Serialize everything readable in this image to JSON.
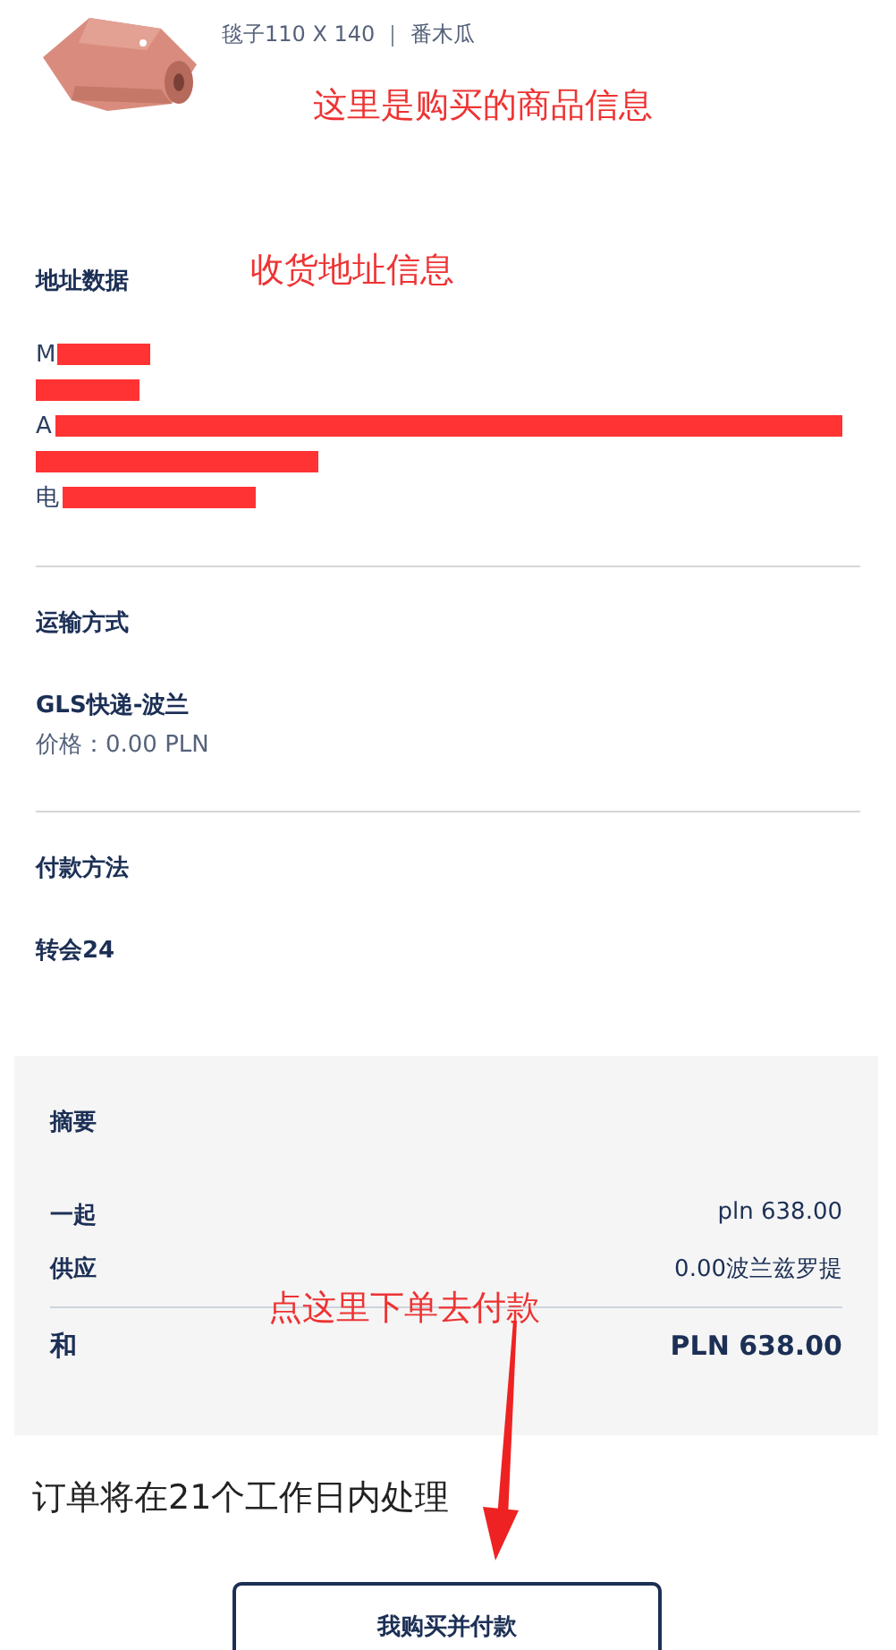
{
  "product": {
    "description": "毯子110 X 140 ｜ 番木瓜",
    "annotation": "这里是购买的商品信息"
  },
  "address": {
    "title": "地址数据",
    "annotation": "收货地址信息",
    "lines": [
      {
        "text": "M",
        "redacted": true
      },
      {
        "redacted": true
      },
      {
        "text": "A",
        "redacted": true
      },
      {
        "redacted": true
      },
      {
        "text": "电",
        "redacted": true
      }
    ]
  },
  "shipping": {
    "title": "运输方式",
    "method": "GLS快递-波兰",
    "price": "价格：0.00 PLN"
  },
  "payment": {
    "title": "付款方法",
    "method": "转会24"
  },
  "summary": {
    "title": "摘要",
    "rows": [
      {
        "label": "一起",
        "value": "pln 638.00"
      },
      {
        "label": "供应",
        "value": "0.00波兰兹罗提"
      }
    ],
    "total": {
      "label": "和",
      "value": "PLN 638.00"
    },
    "annotation": "点这里下单去付款"
  },
  "notice": "订单将在21个工作日内处理",
  "buy_button": "我购买并付款"
}
